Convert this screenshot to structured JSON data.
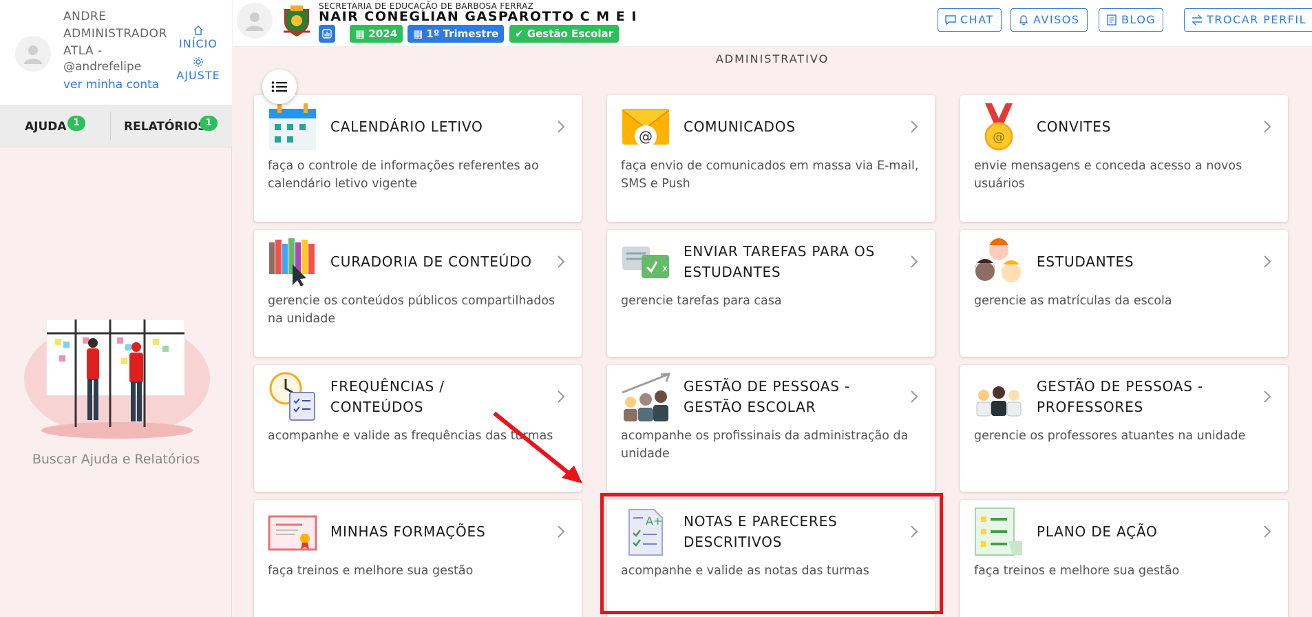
{
  "sidebar": {
    "user_name": "ANDRE ADMINISTRADOR ATLA -",
    "user_handle": "@andrefelipe",
    "account_link": "ver minha conta",
    "home_label": "INÍCIO",
    "settings_label": "AJUSTE",
    "tabs": [
      {
        "label": "AJUDA",
        "badge": "1"
      },
      {
        "label": "RELATÓRIOS",
        "badge": "1"
      }
    ],
    "help_text": "Buscar Ajuda e Relatórios"
  },
  "header": {
    "secretaria": "SECRETARIA DE EDUCAÇÃO DE BARBOSA FERRAZ",
    "school_name": "NAIR CONEGLIAN GASPAROTTO C M E I",
    "chips": {
      "year": "2024",
      "period": "1º Trimestre",
      "mode": "Gestão Escolar"
    },
    "buttons": {
      "chat": "CHAT",
      "avisos": "AVISOS",
      "blog": "BLOG",
      "trocar": "TROCAR PERFIL"
    }
  },
  "main": {
    "section_title": "ADMINISTRATIVO",
    "cards": [
      {
        "title": "CALENDÁRIO LETIVO",
        "desc": "faça o controle de informações referentes ao calendário letivo vigente",
        "icon": "calendar-icon"
      },
      {
        "title": "COMUNICADOS",
        "desc": "faça envio de comunicados em massa via E-mail, SMS e Push",
        "icon": "envelope-icon"
      },
      {
        "title": "CONVITES",
        "desc": "envie mensagens e conceda acesso a novos usuários",
        "icon": "medal-icon"
      },
      {
        "title": "CURADORIA DE CONTEÚDO",
        "desc": "gerencie os conteúdos públicos compartilhados na unidade",
        "icon": "books-icon"
      },
      {
        "title": "ENVIAR TAREFAS PARA OS ESTUDANTES",
        "desc": "gerencie tarefas para casa",
        "icon": "tasks-icon"
      },
      {
        "title": "ESTUDANTES",
        "desc": "gerencie as matrículas da escola",
        "icon": "students-icon"
      },
      {
        "title": "FREQUÊNCIAS / CONTEÚDOS",
        "desc": "acompanhe e valide as frequências das turmas",
        "icon": "attendance-icon"
      },
      {
        "title": "GESTÃO DE PESSOAS - GESTÃO ESCOLAR",
        "desc": "acompanhe os profissinais da administração da unidade",
        "icon": "staff-growth-icon"
      },
      {
        "title": "GESTÃO DE PESSOAS - PROFESSORES",
        "desc": "gerencie os professores atuantes na unidade",
        "icon": "teachers-icon"
      },
      {
        "title": "MINHAS FORMAÇÕES",
        "desc": "faça treinos e melhore sua gestão",
        "icon": "certificate-icon"
      },
      {
        "title": "NOTAS E PARECERES DESCRITIVOS",
        "desc": "acompanhe e valide as notas das turmas",
        "icon": "grades-icon"
      },
      {
        "title": "PLANO DE AÇÃO",
        "desc": "faça treinos e melhore sua gestão",
        "icon": "action-plan-icon"
      }
    ]
  },
  "colors": {
    "accent_blue": "#2d7be0",
    "accent_green": "#2dbf5a",
    "highlight_red": "#e8141a",
    "background": "#fbeeee"
  }
}
